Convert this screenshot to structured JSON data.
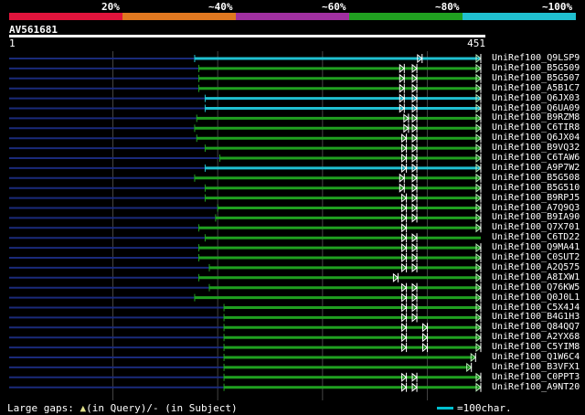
{
  "legend": {
    "labels": [
      "20%",
      "~40%",
      "~60%",
      "~80%",
      "~100%"
    ],
    "colors": [
      "#e0143c",
      "#e07820",
      "#a030a0",
      "#20a020",
      "#20c0d0"
    ]
  },
  "query": {
    "title": "AV561681",
    "start_label": "1",
    "end_label": "451",
    "length": 451
  },
  "colors": {
    "background": "#000000",
    "query_line": "#ffffff",
    "unaligned": "#1a2a7a",
    "green": "#20a020",
    "cyan": "#20c0d0",
    "gridline": "#444444"
  },
  "hits": [
    {
      "name": "UniRef100_Q9LSP9",
      "start": 178,
      "end": 451,
      "color": "cyan",
      "arrows": [
        395,
        451
      ]
    },
    {
      "name": "UniRef100_B5G509",
      "start": 182,
      "end": 451,
      "color": "green",
      "arrows": [
        378,
        390,
        451
      ]
    },
    {
      "name": "UniRef100_B5G507",
      "start": 182,
      "end": 451,
      "color": "green",
      "arrows": [
        378,
        390,
        451
      ]
    },
    {
      "name": "UniRef100_A5B1C7",
      "start": 182,
      "end": 451,
      "color": "green",
      "arrows": [
        378,
        390,
        451
      ]
    },
    {
      "name": "UniRef100_Q6JX03",
      "start": 188,
      "end": 451,
      "color": "cyan",
      "arrows": [
        378,
        390,
        451
      ]
    },
    {
      "name": "UniRef100_Q6UA09",
      "start": 188,
      "end": 451,
      "color": "cyan",
      "arrows": [
        378,
        390,
        451
      ]
    },
    {
      "name": "UniRef100_B9RZM8",
      "start": 180,
      "end": 451,
      "color": "green",
      "arrows": [
        382,
        390,
        451
      ]
    },
    {
      "name": "UniRef100_C6TIR8",
      "start": 178,
      "end": 451,
      "color": "green",
      "arrows": [
        382,
        390,
        451
      ]
    },
    {
      "name": "UniRef100_Q6JX04",
      "start": 180,
      "end": 451,
      "color": "green",
      "arrows": [
        380,
        390,
        451
      ]
    },
    {
      "name": "UniRef100_B9VQ32",
      "start": 188,
      "end": 451,
      "color": "green",
      "arrows": [
        380,
        390,
        451
      ]
    },
    {
      "name": "UniRef100_C6TAW6",
      "start": 202,
      "end": 451,
      "color": "green",
      "arrows": [
        380,
        390,
        451
      ]
    },
    {
      "name": "UniRef100_A9P7W2",
      "start": 188,
      "end": 451,
      "color": "cyan",
      "arrows": [
        380,
        390,
        451
      ]
    },
    {
      "name": "UniRef100_B5G508",
      "start": 178,
      "end": 451,
      "color": "green",
      "arrows": [
        378,
        390,
        451
      ]
    },
    {
      "name": "UniRef100_B5G510",
      "start": 188,
      "end": 451,
      "color": "green",
      "arrows": [
        378,
        390,
        451
      ]
    },
    {
      "name": "UniRef100_B9RPJ5",
      "start": 188,
      "end": 451,
      "color": "green",
      "arrows": [
        380,
        390,
        451
      ]
    },
    {
      "name": "UniRef100_A7Q9Q3",
      "start": 200,
      "end": 451,
      "color": "green",
      "arrows": [
        380,
        390,
        451
      ]
    },
    {
      "name": "UniRef100_B9IA90",
      "start": 198,
      "end": 451,
      "color": "green",
      "arrows": [
        380,
        390,
        451
      ]
    },
    {
      "name": "UniRef100_Q7X701",
      "start": 182,
      "end": 451,
      "color": "green",
      "arrows": [
        380,
        451
      ]
    },
    {
      "name": "UniRef100_C6TD22",
      "start": 188,
      "end": 451,
      "color": "green",
      "arrows": [
        380,
        390
      ]
    },
    {
      "name": "UniRef100_Q9MA41",
      "start": 182,
      "end": 451,
      "color": "green",
      "arrows": [
        380,
        390,
        451
      ]
    },
    {
      "name": "UniRef100_C0SUT2",
      "start": 182,
      "end": 451,
      "color": "green",
      "arrows": [
        380,
        390,
        451
      ]
    },
    {
      "name": "UniRef100_A2Q575",
      "start": 192,
      "end": 451,
      "color": "green",
      "arrows": [
        380,
        390,
        451
      ]
    },
    {
      "name": "UniRef100_A8IXW1",
      "start": 182,
      "end": 451,
      "color": "green",
      "arrows": [
        372,
        451
      ]
    },
    {
      "name": "UniRef100_Q76KW5",
      "start": 192,
      "end": 451,
      "color": "green",
      "arrows": [
        380,
        390,
        451
      ]
    },
    {
      "name": "UniRef100_Q0J0L1",
      "start": 178,
      "end": 451,
      "color": "green",
      "arrows": [
        380,
        390,
        451
      ]
    },
    {
      "name": "UniRef100_C5X4J4",
      "start": 206,
      "end": 451,
      "color": "green",
      "arrows": [
        380,
        390,
        451
      ]
    },
    {
      "name": "UniRef100_B4G1H3",
      "start": 206,
      "end": 451,
      "color": "green",
      "arrows": [
        380,
        390,
        451
      ]
    },
    {
      "name": "UniRef100_Q84QQ7",
      "start": 206,
      "end": 451,
      "color": "green",
      "arrows": [
        380,
        400,
        451
      ]
    },
    {
      "name": "UniRef100_A2YX68",
      "start": 206,
      "end": 451,
      "color": "green",
      "arrows": [
        380,
        400,
        451
      ]
    },
    {
      "name": "UniRef100_C5YIM8",
      "start": 206,
      "end": 451,
      "color": "green",
      "arrows": [
        380,
        400,
        451
      ]
    },
    {
      "name": "UniRef100_Q1W6C4",
      "start": 206,
      "end": 446,
      "color": "green",
      "arrows": [
        446
      ]
    },
    {
      "name": "UniRef100_B3VFX1",
      "start": 206,
      "end": 442,
      "color": "green",
      "arrows": [
        442
      ]
    },
    {
      "name": "UniRef100_C0PPT3",
      "start": 206,
      "end": 451,
      "color": "green",
      "arrows": [
        380,
        390,
        451
      ]
    },
    {
      "name": "UniRef100_A9NT20",
      "start": 206,
      "end": 451,
      "color": "green",
      "arrows": [
        380,
        390,
        451
      ]
    }
  ],
  "footer": {
    "gaps_label": "Large gaps: ",
    "query_tri": "▲",
    "in_query": "(in Query)/- (in Subject)",
    "scale_label": "=100char."
  }
}
